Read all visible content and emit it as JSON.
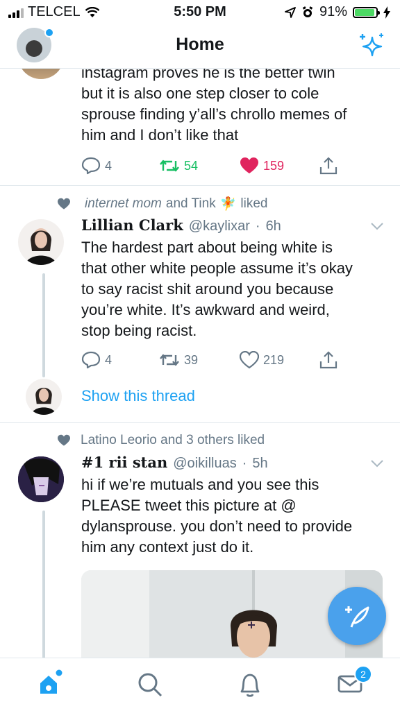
{
  "status_bar": {
    "carrier": "TELCEL",
    "time": "5:50 PM",
    "battery": "91%",
    "battery_level": 0.91
  },
  "nav": {
    "title": "Home"
  },
  "tweet1": {
    "text_lines": [
      "instagram proves he is the better twin",
      "but it is also one step closer to cole",
      "sprouse finding y’all’s chrollo memes of",
      "him and I don’t like that"
    ],
    "replies": "4",
    "retweets": "54",
    "likes": "159"
  },
  "tweet2": {
    "social_context": {
      "names": "internet mom",
      "and": "and Tink",
      "liked": "liked"
    },
    "name": "Lillian Clark",
    "handle": "@kaylixar",
    "time": "6h",
    "text_lines": [
      "The hardest part about being white is",
      "that other white people assume it’s okay",
      "to say racist shit around you because",
      "you’re white. It’s awkward and weird,",
      "stop being racist."
    ],
    "replies": "4",
    "retweets": "39",
    "likes": "219",
    "show_thread": "Show this thread"
  },
  "tweet3": {
    "social_context": "Latino Leorio and 3 others liked",
    "name": "#1 rii stan",
    "handle": "@oikilluas",
    "time": "5h",
    "text_lines": [
      "hi if we’re mutuals and you see this",
      "PLEASE tweet this picture at @",
      "dylansprouse. you don’t need to provide",
      "him any context just do it."
    ]
  },
  "tabbar": {
    "messages_badge": "2"
  },
  "colors": {
    "accent": "#1da1f2",
    "like_red": "#e0245e",
    "retweet_green": "#17bf63",
    "muted": "#657786"
  },
  "icons": [
    "wifi-icon",
    "location-icon",
    "alarm-icon",
    "charging-icon",
    "sparkle-icon",
    "reply-icon",
    "retweet-icon",
    "heart-icon",
    "share-icon",
    "chevron-down-icon",
    "home-icon",
    "search-icon",
    "bell-icon",
    "mail-icon",
    "compose-icon"
  ]
}
